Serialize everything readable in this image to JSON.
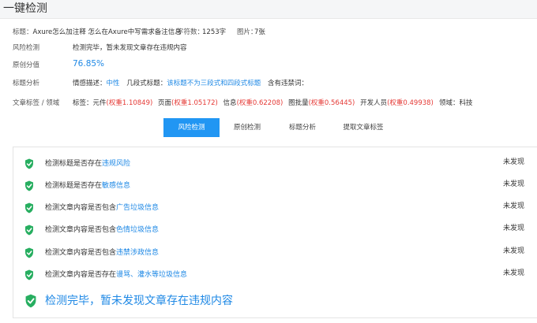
{
  "header": {
    "title": "一键检测"
  },
  "meta": {
    "title_label": "标题：",
    "title_value": "Axure怎么加注释 怎么在Axure中写需求备注信息",
    "chars_label": "字符数：",
    "chars_value": "1253字",
    "images_label": "图片：",
    "images_value": "7张"
  },
  "risk": {
    "label": "风险检测",
    "value": "检测完毕，暂未发现文章存在违规内容"
  },
  "original": {
    "label": "原创分值",
    "value": "76.85%"
  },
  "title_analysis": {
    "label": "标题分析",
    "emotion_label": "情感描述：",
    "emotion_value": "中性",
    "segments_label": "几段式标题：",
    "segments_value": "该标题不为三段式和四段式标题",
    "banned_label": "含有违禁词："
  },
  "tags": {
    "label": "文章标签 / 领域",
    "tags_label": "标签：",
    "items": [
      {
        "name": "元件",
        "weight": "(权重1.10849)"
      },
      {
        "name": "页面",
        "weight": "(权重1.05172)"
      },
      {
        "name": "信息",
        "weight": "(权重0.62208)"
      },
      {
        "name": "图批量",
        "weight": "(权重0.56445)"
      },
      {
        "name": "开发人员",
        "weight": "(权重0.49938)"
      }
    ],
    "domain_label": "领域：",
    "domain_value": "科技"
  },
  "tabs": [
    {
      "label": "风险检测",
      "active": true
    },
    {
      "label": "原创检测",
      "active": false
    },
    {
      "label": "标题分析",
      "active": false
    },
    {
      "label": "提取文章标签",
      "active": false
    }
  ],
  "checks": [
    {
      "prefix": "检测标题是否存在",
      "highlight": "违规风险",
      "status": "未发现"
    },
    {
      "prefix": "检测标题是否存在",
      "highlight": "敏感信息",
      "status": "未发现"
    },
    {
      "prefix": "检测文章内容是否包含",
      "highlight": "广告垃圾信息",
      "status": "未发现"
    },
    {
      "prefix": "检测文章内容是否包含",
      "highlight": "色情垃圾信息",
      "status": "未发现"
    },
    {
      "prefix": "检测文章内容是否包含",
      "highlight": "违禁涉政信息",
      "status": "未发现"
    },
    {
      "prefix": "检测文章内容是否存在",
      "highlight": "谩骂、灌水等垃圾信息",
      "status": "未发现"
    }
  ],
  "final_message": "检测完毕，暂未发现文章存在违规内容",
  "colors": {
    "accent": "#2196f3",
    "link": "#1e88e5",
    "weight": "#e53935",
    "shield": "#27ae60"
  },
  "icons": {
    "check": "shield-check-icon"
  }
}
